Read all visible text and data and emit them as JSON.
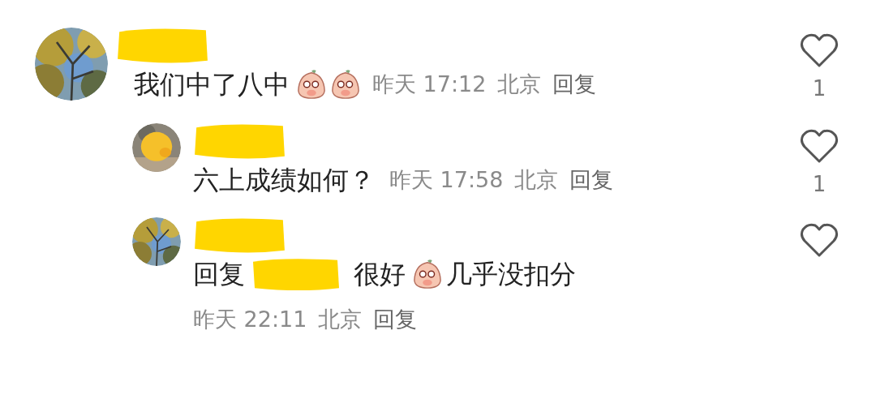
{
  "comments": [
    {
      "kind": "top",
      "body": [
        {
          "kind": "text",
          "text": "我们中了八中"
        },
        {
          "kind": "emoji"
        },
        {
          "kind": "emoji"
        }
      ],
      "time": "昨天 17:12",
      "location": "北京",
      "reply_label": "回复",
      "like_count": "1"
    },
    {
      "kind": "reply",
      "body": [
        {
          "kind": "text",
          "text": "六上成绩如何？"
        }
      ],
      "time": "昨天 17:58",
      "location": "北京",
      "reply_label": "回复",
      "like_count": "1"
    },
    {
      "kind": "reply",
      "body": [
        {
          "kind": "text",
          "text": "回复"
        },
        {
          "kind": "redacted"
        },
        {
          "kind": "text",
          "text": "很好"
        },
        {
          "kind": "emoji"
        },
        {
          "kind": "text",
          "text": "几乎没扣分"
        }
      ],
      "time": "昨天 22:11",
      "location": "北京",
      "reply_label": "回复"
    }
  ]
}
